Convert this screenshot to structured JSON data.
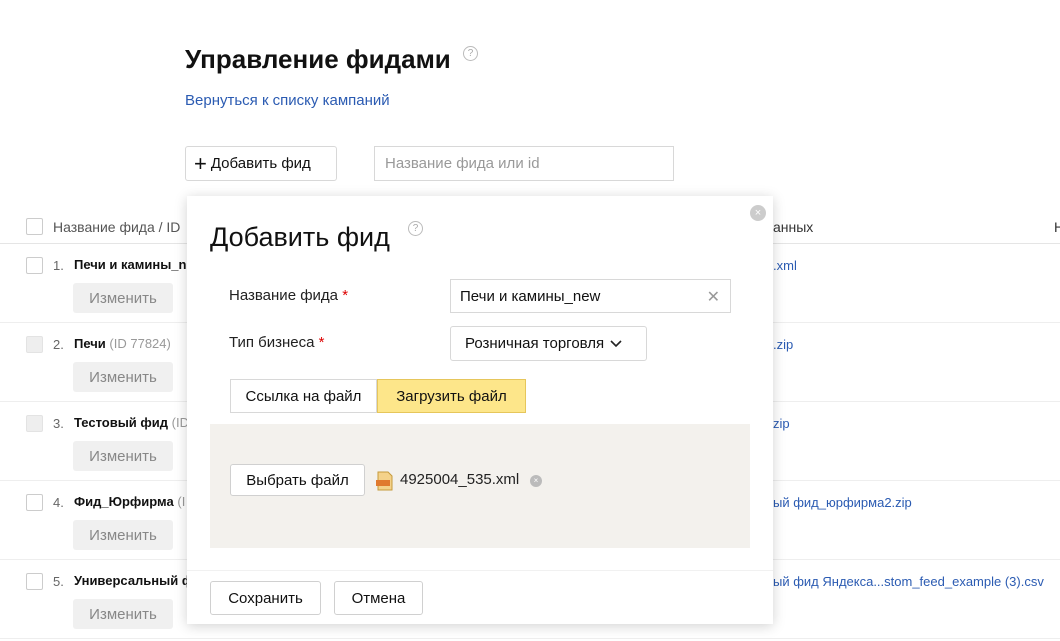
{
  "page": {
    "title": "Управление фидами",
    "help_glyph": "?",
    "back_link": "Вернуться к списку кампаний"
  },
  "toolbar": {
    "add_feed_label": "Добавить фид",
    "search_placeholder": "Название фида или id"
  },
  "table": {
    "header_name": "Название фида / ID",
    "header_data": "анных",
    "header_right": "Н",
    "edit_label": "Изменить",
    "rows": [
      {
        "num": "1.",
        "name": "Печи и камины_new",
        "id": "",
        "file": ".xml",
        "checkbox_disabled": false
      },
      {
        "num": "2.",
        "name": "Печи",
        "id": "(ID 77824)",
        "file": ".zip",
        "checkbox_disabled": true
      },
      {
        "num": "3.",
        "name": "Тестовый фид",
        "id": "(ID",
        "file": "zip",
        "checkbox_disabled": true
      },
      {
        "num": "4.",
        "name": "Фид_Юрфирма",
        "id": "(I",
        "file": "ый фид_юрфирма2.zip",
        "checkbox_disabled": false
      },
      {
        "num": "5.",
        "name": "Универсальный ф",
        "id": "",
        "file": "ый фид Яндекса...stom_feed_example (3).csv",
        "checkbox_disabled": false
      }
    ]
  },
  "modal": {
    "title": "Добавить фид",
    "close_glyph": "×",
    "name_label": "Название фида",
    "required_mark": "*",
    "name_value": "Печи и камины_new",
    "clear_glyph": "✕",
    "business_label": "Тип бизнеса",
    "business_value": "Розничная торговля",
    "tab_link_label": "Ссылка на файл",
    "tab_upload_label": "Загрузить файл",
    "choose_file_label": "Выбрать файл",
    "file_name": "4925004_535.xml",
    "save_label": "Сохранить",
    "cancel_label": "Отмена",
    "active_tab_color": "#fde68a"
  }
}
